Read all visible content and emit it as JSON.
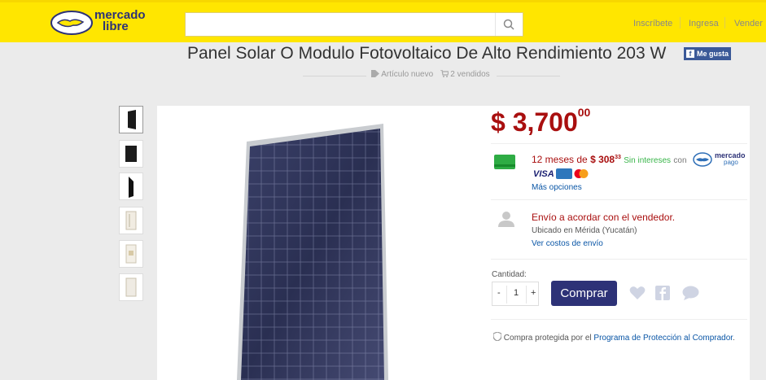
{
  "header": {
    "logo_text": "mercado\nlibre",
    "logo_line1": "mercado",
    "logo_line2": "libre",
    "search_placeholder": "",
    "nav": {
      "signup": "Inscríbete",
      "login": "Ingresa",
      "sell": "Vender"
    },
    "colors": {
      "bar": "#ffe600",
      "brand_blue": "#2d3277"
    }
  },
  "product": {
    "title": "Panel Solar O Modulo Fotovoltaico De Alto Rendimiento 203 W",
    "facebook_like": "Me gusta",
    "condition": "Artículo nuevo",
    "sold": "2 vendidos",
    "thumbnails": [
      "panel-front-dark",
      "panel-front",
      "panel-side",
      "panel-back",
      "panel-label",
      "panel-back-2"
    ]
  },
  "buybox": {
    "currency": "$",
    "price_int": "3,700",
    "price_dec": "00",
    "installments_prefix": "12 meses de",
    "installment_amount": "$ 308",
    "installment_dec": "33",
    "no_interest": "Sin intereses",
    "with": "con",
    "mp_line1": "mercado",
    "mp_line2": "pago",
    "visa": "VISA",
    "more_options": "Más opciones",
    "shipping": "Envío a acordar con el vendedor.",
    "location": "Ubicado en Mérida (Yucatán)",
    "shipping_costs": "Ver costos de envío",
    "quantity_label": "Cantidad:",
    "quantity_minus": "-",
    "quantity_value": "1",
    "quantity_plus": "+",
    "buy_label": "Comprar",
    "protection_prefix": "Compra protegida por el",
    "protection_link": "Programa de Protección al Comprador",
    "protection_suffix": ".",
    "colors": {
      "price": "#a90f0f",
      "link": "#0a56a6",
      "green": "#39b54a"
    }
  }
}
